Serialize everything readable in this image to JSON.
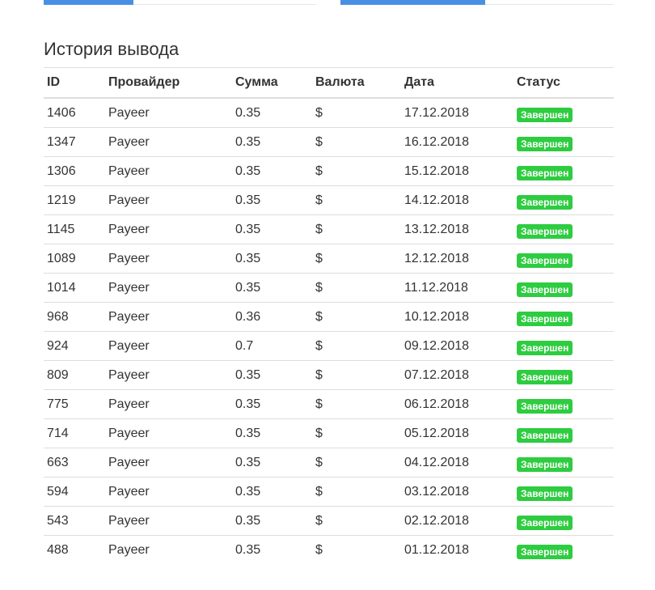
{
  "section_title": "История вывода",
  "accent_color": "#4a90e2",
  "status_color": "#2ecc40",
  "top_progress": [
    {
      "fill_fraction": 0.33
    },
    {
      "fill_fraction": 0.53
    }
  ],
  "table": {
    "headers": [
      "ID",
      "Провайдер",
      "Сумма",
      "Валюта",
      "Дата",
      "Статус"
    ],
    "rows": [
      {
        "id": "1406",
        "provider": "Payeer",
        "amount": "0.35",
        "currency": "$",
        "date": "17.12.2018",
        "status": "Завершен"
      },
      {
        "id": "1347",
        "provider": "Payeer",
        "amount": "0.35",
        "currency": "$",
        "date": "16.12.2018",
        "status": "Завершен"
      },
      {
        "id": "1306",
        "provider": "Payeer",
        "amount": "0.35",
        "currency": "$",
        "date": "15.12.2018",
        "status": "Завершен"
      },
      {
        "id": "1219",
        "provider": "Payeer",
        "amount": "0.35",
        "currency": "$",
        "date": "14.12.2018",
        "status": "Завершен"
      },
      {
        "id": "1145",
        "provider": "Payeer",
        "amount": "0.35",
        "currency": "$",
        "date": "13.12.2018",
        "status": "Завершен"
      },
      {
        "id": "1089",
        "provider": "Payeer",
        "amount": "0.35",
        "currency": "$",
        "date": "12.12.2018",
        "status": "Завершен"
      },
      {
        "id": "1014",
        "provider": "Payeer",
        "amount": "0.35",
        "currency": "$",
        "date": "11.12.2018",
        "status": "Завершен"
      },
      {
        "id": "968",
        "provider": "Payeer",
        "amount": "0.36",
        "currency": "$",
        "date": "10.12.2018",
        "status": "Завершен"
      },
      {
        "id": "924",
        "provider": "Payeer",
        "amount": "0.7",
        "currency": "$",
        "date": "09.12.2018",
        "status": "Завершен"
      },
      {
        "id": "809",
        "provider": "Payeer",
        "amount": "0.35",
        "currency": "$",
        "date": "07.12.2018",
        "status": "Завершен"
      },
      {
        "id": "775",
        "provider": "Payeer",
        "amount": "0.35",
        "currency": "$",
        "date": "06.12.2018",
        "status": "Завершен"
      },
      {
        "id": "714",
        "provider": "Payeer",
        "amount": "0.35",
        "currency": "$",
        "date": "05.12.2018",
        "status": "Завершен"
      },
      {
        "id": "663",
        "provider": "Payeer",
        "amount": "0.35",
        "currency": "$",
        "date": "04.12.2018",
        "status": "Завершен"
      },
      {
        "id": "594",
        "provider": "Payeer",
        "amount": "0.35",
        "currency": "$",
        "date": "03.12.2018",
        "status": "Завершен"
      },
      {
        "id": "543",
        "provider": "Payeer",
        "amount": "0.35",
        "currency": "$",
        "date": "02.12.2018",
        "status": "Завершен"
      },
      {
        "id": "488",
        "provider": "Payeer",
        "amount": "0.35",
        "currency": "$",
        "date": "01.12.2018",
        "status": "Завершен"
      }
    ]
  }
}
